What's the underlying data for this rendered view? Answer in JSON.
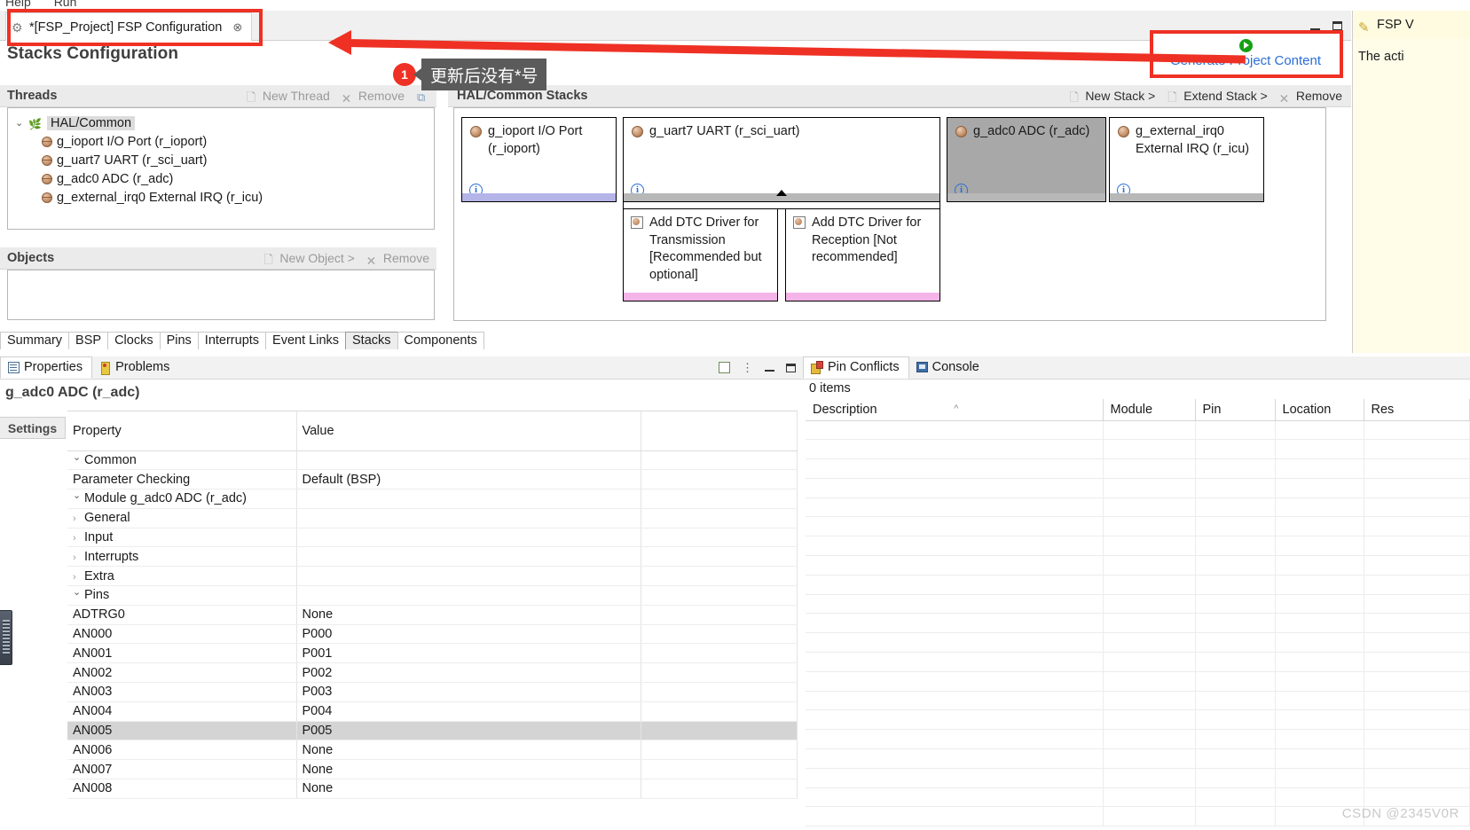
{
  "menu": {
    "items": [
      "Help",
      "Run"
    ]
  },
  "editor": {
    "tab_label": "*[FSP_Project] FSP Configuration",
    "tab_close": "⊗",
    "page_title": "Stacks Configuration",
    "window_controls": {
      "minimize": "minimize-icon",
      "maximize": "maximize-icon"
    }
  },
  "generate": {
    "label": "Generate Project Content",
    "icon": "play-icon",
    "link_color": "#2a6fd6"
  },
  "threads": {
    "title": "Threads",
    "actions": [
      {
        "label": "New Thread",
        "icon": "new-thread-icon"
      },
      {
        "label": "Remove",
        "icon": "remove-icon"
      }
    ],
    "extra_icon": "copy-icon",
    "tree": {
      "root": {
        "label": "HAL/Common",
        "icon": "hal-common-icon",
        "expanded": true
      },
      "children": [
        {
          "label": "g_ioport I/O Port (r_ioport)",
          "icon": "module-icon"
        },
        {
          "label": "g_uart7 UART (r_sci_uart)",
          "icon": "module-icon"
        },
        {
          "label": "g_adc0 ADC (r_adc)",
          "icon": "module-icon"
        },
        {
          "label": "g_external_irq0 External IRQ (r_icu)",
          "icon": "module-icon"
        }
      ]
    }
  },
  "objects": {
    "title": "Objects",
    "actions": [
      {
        "label": "New Object >",
        "icon": "new-object-icon"
      },
      {
        "label": "Remove",
        "icon": "remove-icon"
      }
    ]
  },
  "stacks": {
    "title": "HAL/Common Stacks",
    "actions": [
      {
        "label": "New Stack >",
        "icon": "new-stack-icon"
      },
      {
        "label": "Extend Stack >",
        "icon": "extend-stack-icon"
      },
      {
        "label": "Remove",
        "icon": "remove-icon"
      }
    ],
    "boxes": [
      {
        "label": "g_ioport I/O Port (r_ioport)",
        "info": "i",
        "footer_color": "#b4b4e8",
        "selected": false
      },
      {
        "label": "g_uart7 UART (r_sci_uart)",
        "info": "i",
        "footer_color": "#b8b8b8",
        "selected": false
      },
      {
        "label": "g_adc0 ADC (r_adc)",
        "info": "i",
        "footer_color": "#b8b8b8",
        "selected": true
      },
      {
        "label": "g_external_irq0 External IRQ (r_icu)",
        "info": "i",
        "footer_color": "#b8b8b8",
        "selected": false
      }
    ],
    "children": [
      {
        "label": "Add DTC Driver for Transmission [Recommended but optional]",
        "footer_color": "#f4b4e8"
      },
      {
        "label": "Add DTC Driver for Reception [Not recommended]",
        "footer_color": "#f4b4e8"
      }
    ]
  },
  "config_tabs": {
    "items": [
      "Summary",
      "BSP",
      "Clocks",
      "Pins",
      "Interrupts",
      "Event Links",
      "Stacks",
      "Components"
    ],
    "active": "Stacks"
  },
  "properties_view": {
    "tabs": [
      {
        "label": "Properties",
        "icon": "properties-icon",
        "active": true
      },
      {
        "label": "Problems",
        "icon": "problems-icon",
        "active": false
      }
    ],
    "selected_title": "g_adc0 ADC (r_adc)",
    "side_tab": "Settings",
    "columns": [
      "Property",
      "Value"
    ],
    "rows": [
      {
        "indent": 0,
        "twisty": "open",
        "property": "Common",
        "value": ""
      },
      {
        "indent": 1,
        "twisty": "none",
        "property": "Parameter Checking",
        "value": "Default (BSP)"
      },
      {
        "indent": 0,
        "twisty": "open",
        "property": "Module g_adc0 ADC (r_adc)",
        "value": ""
      },
      {
        "indent": 1,
        "twisty": "closed",
        "property": "General",
        "value": ""
      },
      {
        "indent": 1,
        "twisty": "closed",
        "property": "Input",
        "value": ""
      },
      {
        "indent": 1,
        "twisty": "closed",
        "property": "Interrupts",
        "value": ""
      },
      {
        "indent": 1,
        "twisty": "closed",
        "property": "Extra",
        "value": ""
      },
      {
        "indent": 0,
        "twisty": "open",
        "property": "Pins",
        "value": ""
      },
      {
        "indent": 1,
        "twisty": "none",
        "property": "ADTRG0",
        "value": "None"
      },
      {
        "indent": 1,
        "twisty": "none",
        "property": "AN000",
        "value": "P000"
      },
      {
        "indent": 1,
        "twisty": "none",
        "property": "AN001",
        "value": "P001"
      },
      {
        "indent": 1,
        "twisty": "none",
        "property": "AN002",
        "value": "P002"
      },
      {
        "indent": 1,
        "twisty": "none",
        "property": "AN003",
        "value": "P003"
      },
      {
        "indent": 1,
        "twisty": "none",
        "property": "AN004",
        "value": "P004"
      },
      {
        "indent": 1,
        "twisty": "none",
        "property": "AN005",
        "value": "P005",
        "selected": true
      },
      {
        "indent": 1,
        "twisty": "none",
        "property": "AN006",
        "value": "None"
      },
      {
        "indent": 1,
        "twisty": "none",
        "property": "AN007",
        "value": "None"
      },
      {
        "indent": 1,
        "twisty": "none",
        "property": "AN008",
        "value": "None"
      }
    ]
  },
  "pin_conflicts": {
    "tabs": [
      {
        "label": "Pin Conflicts",
        "icon": "pin-conflicts-icon",
        "active": true
      },
      {
        "label": "Console",
        "icon": "console-icon",
        "active": false
      }
    ],
    "count_text": "0 items",
    "columns": [
      "Description",
      "Module",
      "Pin",
      "Location",
      "Res"
    ],
    "sort_indicator": "^",
    "rows": []
  },
  "fsp_sidebar": {
    "tab_label": "FSP V",
    "body_text": "The acti",
    "icon": "pencil-icon"
  },
  "annotations": {
    "badge": "1",
    "tooltip": "更新后没有*号",
    "highlight_color": "#ee3124"
  },
  "watermark": "CSDN @2345V0R"
}
